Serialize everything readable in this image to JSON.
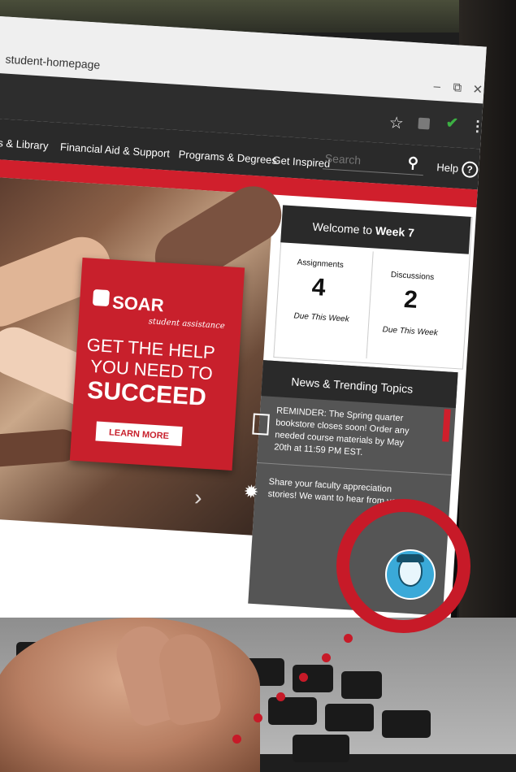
{
  "browser": {
    "tab_title": "student-homepage",
    "window_minimize": "–",
    "window_restore": "⧉",
    "window_close": "✕",
    "star_icon": "star-icon",
    "check_icon": "check-icon",
    "menu_icon": "⋮"
  },
  "nav": {
    "items": [
      "us & Library",
      "Financial Aid & Support",
      "Programs & Degrees",
      "Get Inspired"
    ],
    "search_placeholder": "Search",
    "help_label": "Help",
    "help_icon_glyph": "?"
  },
  "hero": {
    "brand": "SOAR",
    "brand_sub": "student assistance",
    "line1": "GET THE HELP",
    "line2": "YOU NEED TO",
    "line3": "SUCCEED",
    "cta": "LEARN MORE",
    "next_glyph": "›"
  },
  "welcome": {
    "prefix": "Welcome to",
    "week": "Week 7",
    "assignments_label": "Assignments",
    "assignments_value": "4",
    "assignments_due": "Due This Week",
    "discussions_label": "Discussions",
    "discussions_value": "2",
    "discussions_due": "Due This Week"
  },
  "news": {
    "title": "News & Trending Topics",
    "items": [
      "REMINDER: The Spring quarter bookstore closes soon! Order any needed course materials by May 20th at 11:59 PM EST.",
      "Share your faculty appreciation stories! We want to hear from you."
    ]
  },
  "colors": {
    "brand_red": "#d01f2c",
    "nav_dark": "#2a2a2a",
    "chat_blue": "#3aa9d8"
  },
  "icons": {
    "search": "search-icon",
    "help": "help-icon",
    "chatbot": "chatbot-avatar-icon",
    "book": "book-icon",
    "starburst": "starburst-icon"
  }
}
